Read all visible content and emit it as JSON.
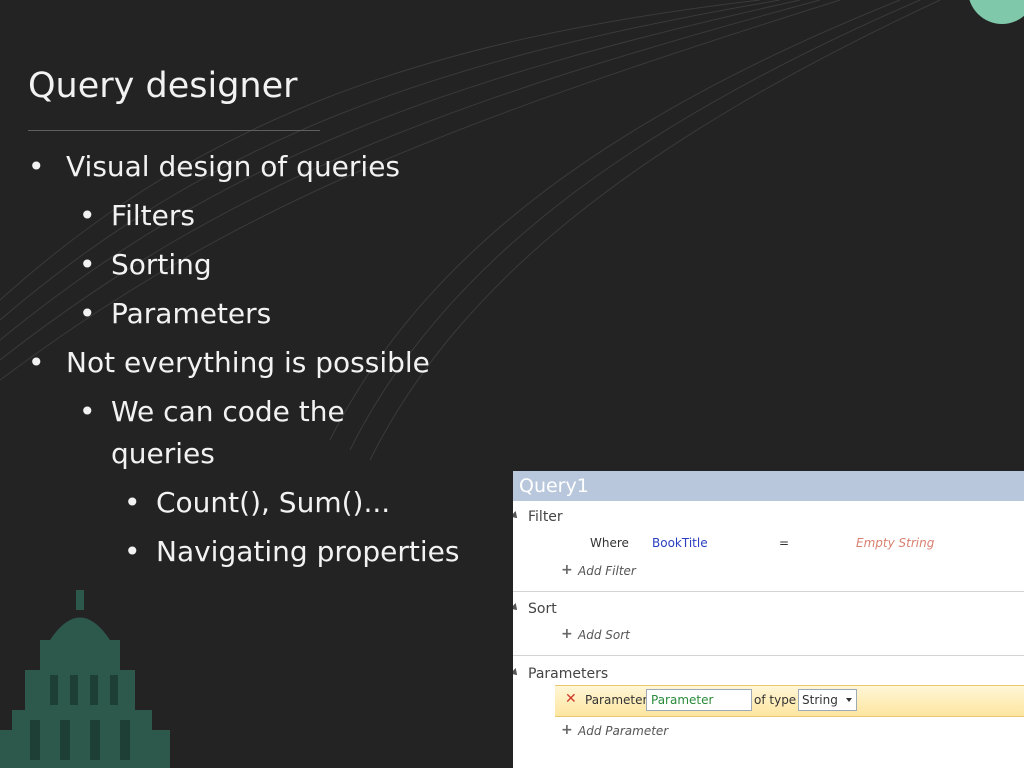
{
  "slide": {
    "title": "Query designer",
    "bullets": [
      {
        "level": 1,
        "text": "Visual design of queries"
      },
      {
        "level": 2,
        "text": "Filters"
      },
      {
        "level": 2,
        "text": "Sorting"
      },
      {
        "level": 2,
        "text": "Parameters"
      },
      {
        "level": 1,
        "text": "Not everything is possible"
      },
      {
        "level": 2,
        "text": "We can code the"
      },
      {
        "level": 2,
        "text": "queries"
      },
      {
        "level": 3,
        "text": "Count(), Sum()..."
      },
      {
        "level": 3,
        "text": "Navigating properties"
      }
    ],
    "bullet_char": "•"
  },
  "query": {
    "title": "Query1",
    "filter": {
      "label": "Filter",
      "where_label": "Where",
      "field": "BookTitle",
      "operator": "=",
      "value": "Empty String",
      "add_label": "Add Filter"
    },
    "sort": {
      "label": "Sort",
      "add_label": "Add Sort"
    },
    "parameters": {
      "label": "Parameters",
      "param_label": "Parameter",
      "param_value": "Parameter",
      "of_type_label": "of type",
      "type_value": "String",
      "add_label": "Add Parameter"
    },
    "plus_glyph": "+",
    "remove_glyph": "✕"
  },
  "colors": {
    "background": "#232323",
    "accent_circle": "#7fc8a9",
    "panel_header": "#b8c7dc",
    "field_blue": "#2a3fbf",
    "value_red": "#d98070",
    "param_green": "#2a8a3a"
  }
}
